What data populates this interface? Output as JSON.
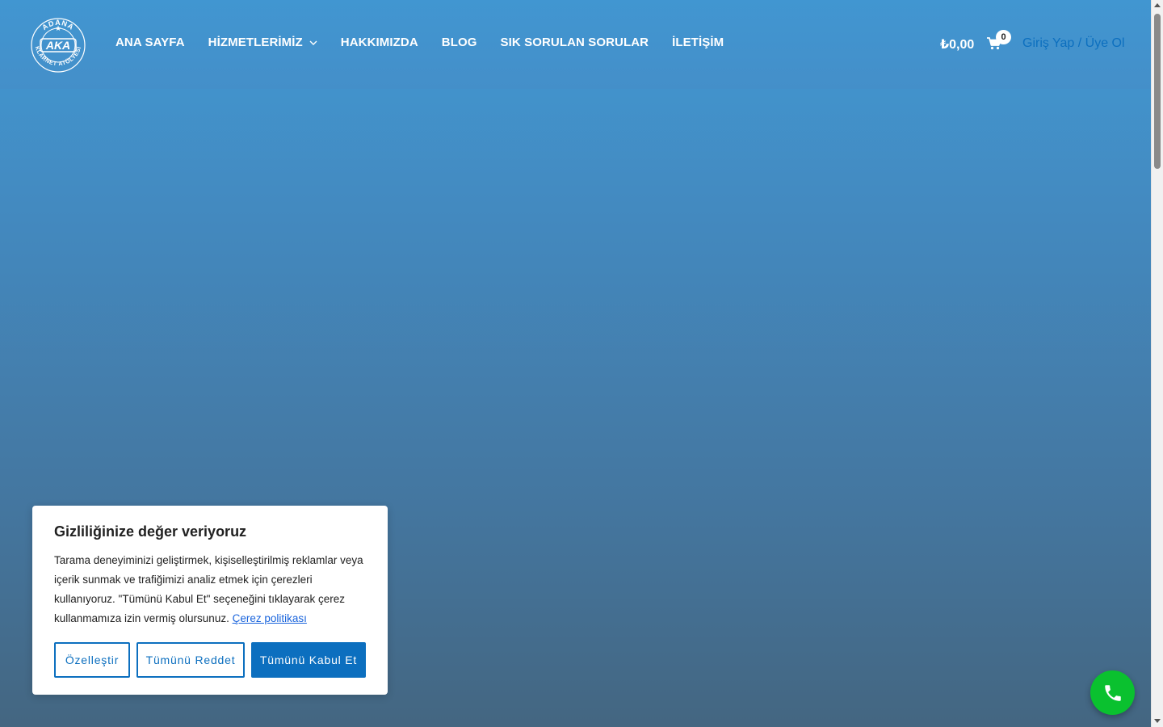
{
  "header": {
    "logo": {
      "top_text": "ADANA",
      "center_text": "AKA",
      "ring_text": "KLARNET ATÖLYESİ"
    },
    "nav": [
      {
        "label": "ANA SAYFA"
      },
      {
        "label": "HİZMETLERİMİZ",
        "has_dropdown": true
      },
      {
        "label": "HAKKIMIZDA"
      },
      {
        "label": "BLOG"
      },
      {
        "label": "SIK SORULAN SORULAR"
      },
      {
        "label": "İLETİŞİM"
      }
    ],
    "cart_total": "₺0,00",
    "cart_count": "0",
    "login_label": "Giriş Yap / Üye Ol"
  },
  "cookie_banner": {
    "title": "Gizliliğinize değer veriyoruz",
    "text": "Tarama deneyiminizi geliştirmek, kişiselleştirilmiş reklamlar veya içerik sunmak ve trafiğimizi analiz etmek için çerezleri kullanıyoruz. \"Tümünü Kabul Et\" seçeneğini tıklayarak çerez kullanmamıza izin vermiş olursunuz.",
    "policy_link": "Çerez politikası",
    "buttons": {
      "customize": "Özelleştir",
      "reject_all": "Tümünü Reddet",
      "accept_all": "Tümünü Kabul Et"
    }
  },
  "call_button": {
    "icon": "phone-icon"
  },
  "colors": {
    "header_bg": "#4196d1",
    "accent": "#0c6fbf",
    "call_button": "#0ac12f"
  }
}
